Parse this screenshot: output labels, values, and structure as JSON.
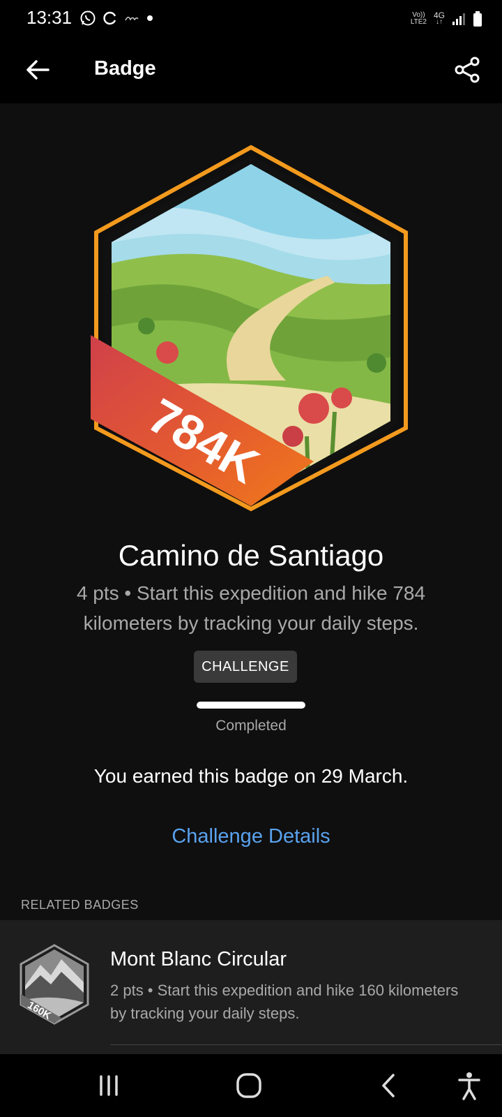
{
  "status_bar": {
    "time": "13:31",
    "network_top": "Vo))",
    "network_bottom": "LTE2",
    "network_type": "4G",
    "icons": [
      "whatsapp-icon",
      "sync-icon",
      "app-icon",
      "dot-icon",
      "signal-icon",
      "battery-icon"
    ]
  },
  "app_bar": {
    "title": "Badge",
    "back_icon": "arrow-left-icon",
    "share_icon": "share-icon"
  },
  "badge": {
    "art_label": "784K",
    "name": "Camino de Santiago",
    "description": "4 pts • Start this expedition and hike 784 kilometers by tracking your daily steps.",
    "chip": "CHALLENGE",
    "progress_fraction": 1.0,
    "progress_label": "Completed",
    "earned_text": "You earned this badge on 29 March.",
    "details_link": "Challenge Details"
  },
  "related": {
    "section_label": "RELATED BADGES",
    "items": [
      {
        "art_label": "160K",
        "title": "Mont Blanc Circular",
        "description": "2 pts • Start this expedition and hike 160 kilometers by tracking your daily steps."
      }
    ]
  },
  "nav_bar": {
    "icons": [
      "recent-apps-icon",
      "home-icon",
      "back-icon",
      "accessibility-icon"
    ]
  },
  "colors": {
    "background": "#0f0f0f",
    "link": "#5aa2ee",
    "badge_border": "#f39a1e",
    "banner_red": "#d0404a",
    "banner_orange": "#f07a1a"
  }
}
